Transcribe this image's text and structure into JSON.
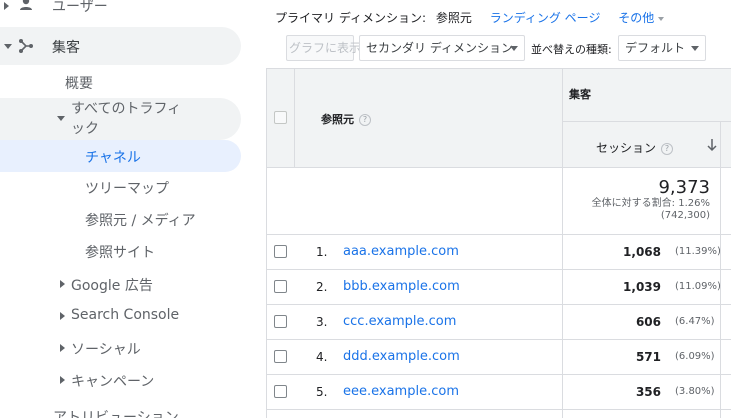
{
  "sidebar": {
    "users": "ユーザー",
    "acquisition": "集客",
    "overview": "概要",
    "all_traffic": "すべてのトラフィック",
    "channels": "チャネル",
    "treemap": "ツリーマップ",
    "source_medium": "参照元 / メディア",
    "referrals": "参照サイト",
    "google_ads": "Google 広告",
    "search_console": "Search Console",
    "social": "ソーシャル",
    "campaigns": "キャンペーン",
    "attribution": "アトリビューション"
  },
  "dimensions": {
    "label": "プライマリ ディメンション:",
    "current": "参照元",
    "landing": "ランディング ページ",
    "other": "その他"
  },
  "toolbar": {
    "graph_button": "グラフに表示",
    "secondary_dimension": "セカンダリ ディメンション",
    "sort_label": "並べ替えの種類:",
    "sort_value": "デフォルト"
  },
  "table": {
    "col_source": "参照元",
    "group_acquisition": "集客",
    "col_sessions": "セッション",
    "total": {
      "value": "9,373",
      "pct_label": "全体に対する割合: 1.26%",
      "overall": "(742,300)"
    },
    "rows": [
      {
        "num": "1.",
        "source": "aaa.example.com",
        "sessions": "1,068",
        "pct": "(11.39%)"
      },
      {
        "num": "2.",
        "source": "bbb.example.com",
        "sessions": "1,039",
        "pct": "(11.09%)"
      },
      {
        "num": "3.",
        "source": "ccc.example.com",
        "sessions": "606",
        "pct": "(6.47%)"
      },
      {
        "num": "4.",
        "source": "ddd.example.com",
        "sessions": "571",
        "pct": "(6.09%)"
      },
      {
        "num": "5.",
        "source": "eee.example.com",
        "sessions": "356",
        "pct": "(3.80%)"
      }
    ]
  },
  "colors": {
    "accent": "#1a73e8",
    "selected_bg": "#e8f0fe",
    "hover_bg": "#f1f3f4"
  }
}
